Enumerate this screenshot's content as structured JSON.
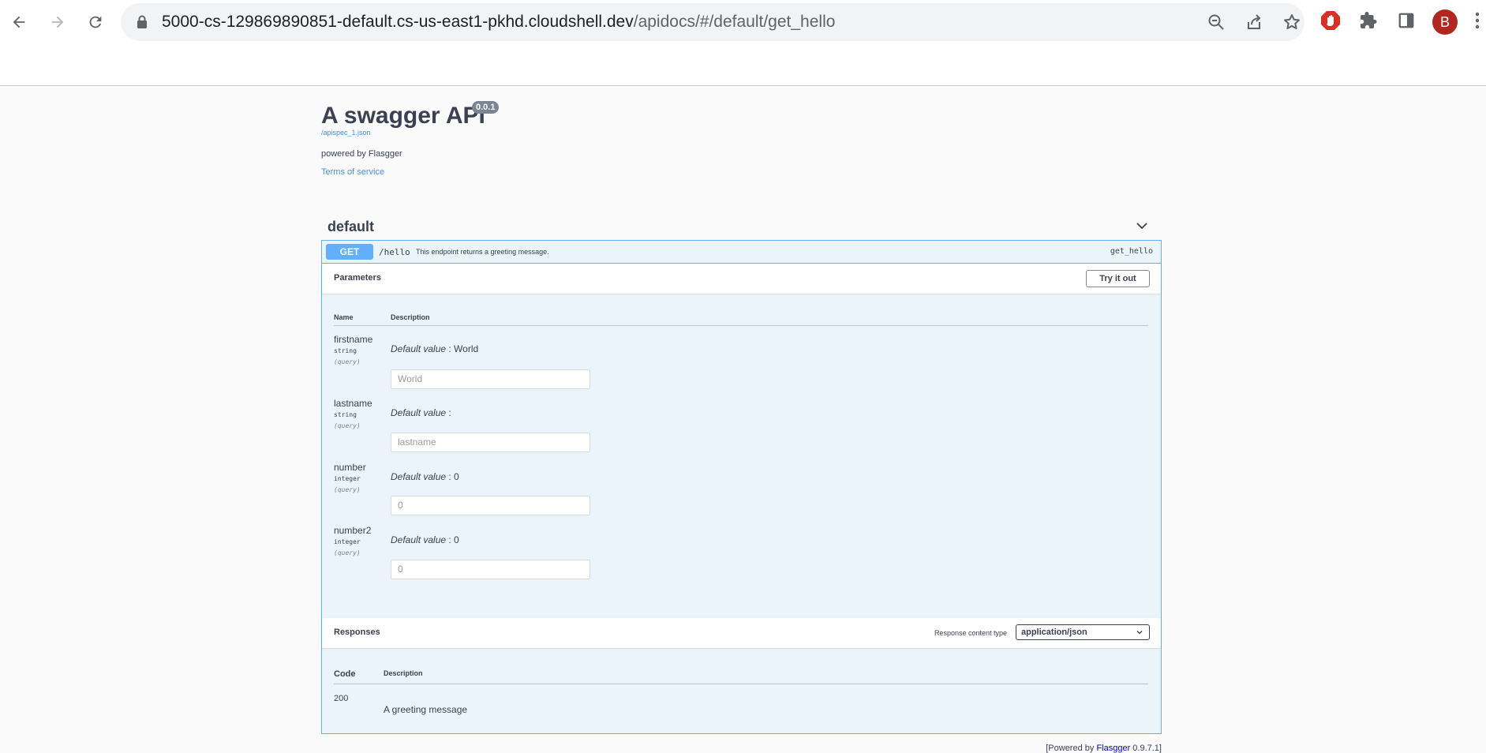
{
  "browser": {
    "url_host": "5000-cs-129869890851-default.cs-us-east1-pkhd.cloudshell.dev",
    "url_path": "/apidocs/#/default/get_hello",
    "avatar_letter": "B",
    "colors": {
      "avatar": "#b3261e",
      "extension": "#d93025"
    }
  },
  "api": {
    "title": "A swagger API",
    "version": "0.0.1",
    "spec_link": "/apispec_1.json",
    "powered": "powered by Flasgger",
    "terms": "Terms of service"
  },
  "tag": {
    "name": "default"
  },
  "operation": {
    "method": "GET",
    "path": "/hello",
    "summary": "This endpoint returns a greeting message.",
    "operation_id": "get_hello",
    "parameters_title": "Parameters",
    "try_label": "Try it out",
    "col_name": "Name",
    "col_description": "Description",
    "params": [
      {
        "name": "firstname",
        "type": "string",
        "in": "(query)",
        "default_label": "Default value",
        "default_value": ": World",
        "placeholder": "World"
      },
      {
        "name": "lastname",
        "type": "string",
        "in": "(query)",
        "default_label": "Default value",
        "default_value": ":",
        "placeholder": "lastname"
      },
      {
        "name": "number",
        "type": "integer",
        "in": "(query)",
        "default_label": "Default value",
        "default_value": ": 0",
        "placeholder": "0"
      },
      {
        "name": "number2",
        "type": "integer",
        "in": "(query)",
        "default_label": "Default value",
        "default_value": ": 0",
        "placeholder": "0"
      }
    ],
    "responses_title": "Responses",
    "response_content_type_label": "Response content type",
    "response_content_type": "application/json",
    "col_code": "Code",
    "responses": [
      {
        "code": "200",
        "description": "A greeting message"
      }
    ]
  },
  "footer": {
    "prefix": "[Powered by ",
    "link": "Flasgger",
    "suffix": " 0.9.7.1]"
  },
  "colors": {
    "get_method": "#61affe",
    "op_bg": "#ebf3fb",
    "link": "#4990e2"
  }
}
